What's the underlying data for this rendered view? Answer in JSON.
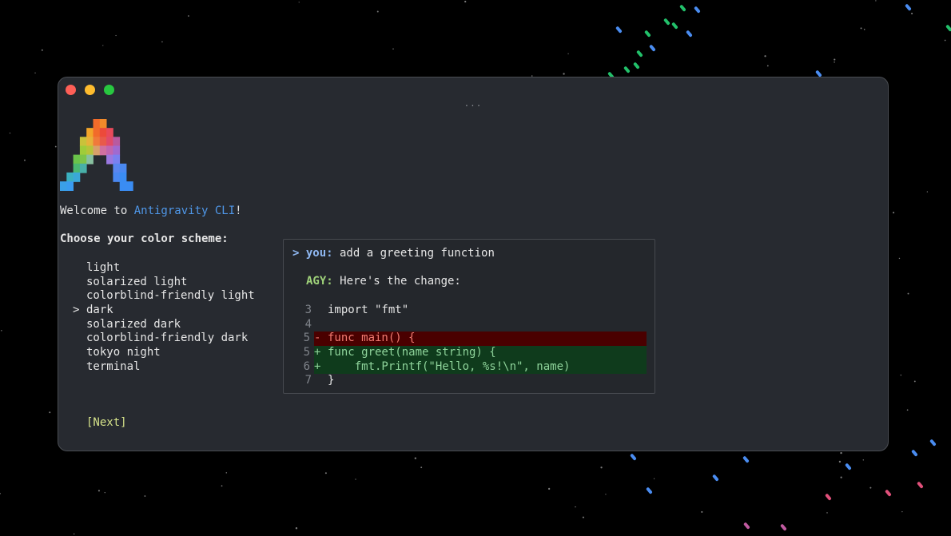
{
  "welcome": {
    "prefix": "Welcome to ",
    "app_name": "Antigravity CLI",
    "suffix": "!"
  },
  "scheme_prompt": "Choose your color scheme:",
  "schemes": [
    {
      "label": "light",
      "cursor": ""
    },
    {
      "label": "solarized light",
      "cursor": ""
    },
    {
      "label": "colorblind-friendly light",
      "cursor": ""
    },
    {
      "label": "dark",
      "cursor": ">"
    },
    {
      "label": "solarized dark",
      "cursor": ""
    },
    {
      "label": "colorblind-friendly dark",
      "cursor": ""
    },
    {
      "label": "tokyo night",
      "cursor": ""
    },
    {
      "label": "terminal",
      "cursor": ""
    }
  ],
  "selected_scheme": "dark",
  "next_label": "[Next]",
  "window_title_dots": "...",
  "preview": {
    "you_prompt": "> ",
    "you_label": "you:",
    "you_text": " add a greeting function",
    "agy_label": "AGY:",
    "agy_text": " Here's the change:",
    "code": [
      {
        "ln": "3",
        "mark": "",
        "text": "import \"fmt\"",
        "kind": "ctx"
      },
      {
        "ln": "4",
        "mark": "",
        "text": "",
        "kind": "ctx"
      },
      {
        "ln": "5",
        "mark": "-",
        "text": "func main() {",
        "kind": "del"
      },
      {
        "ln": "5",
        "mark": "+",
        "text": "func greet(name string) {",
        "kind": "add"
      },
      {
        "ln": "6",
        "mark": "+",
        "text": "    fmt.Printf(\"Hello, %s!\\n\", name)",
        "kind": "add"
      },
      {
        "ln": "7",
        "mark": "",
        "text": "}",
        "kind": "ctx"
      }
    ]
  },
  "colors": {
    "accent": "#4f97e8",
    "next": "#d6e38a",
    "diff_del_bg": "#4a0000",
    "diff_add_bg": "#0f3b1c"
  }
}
